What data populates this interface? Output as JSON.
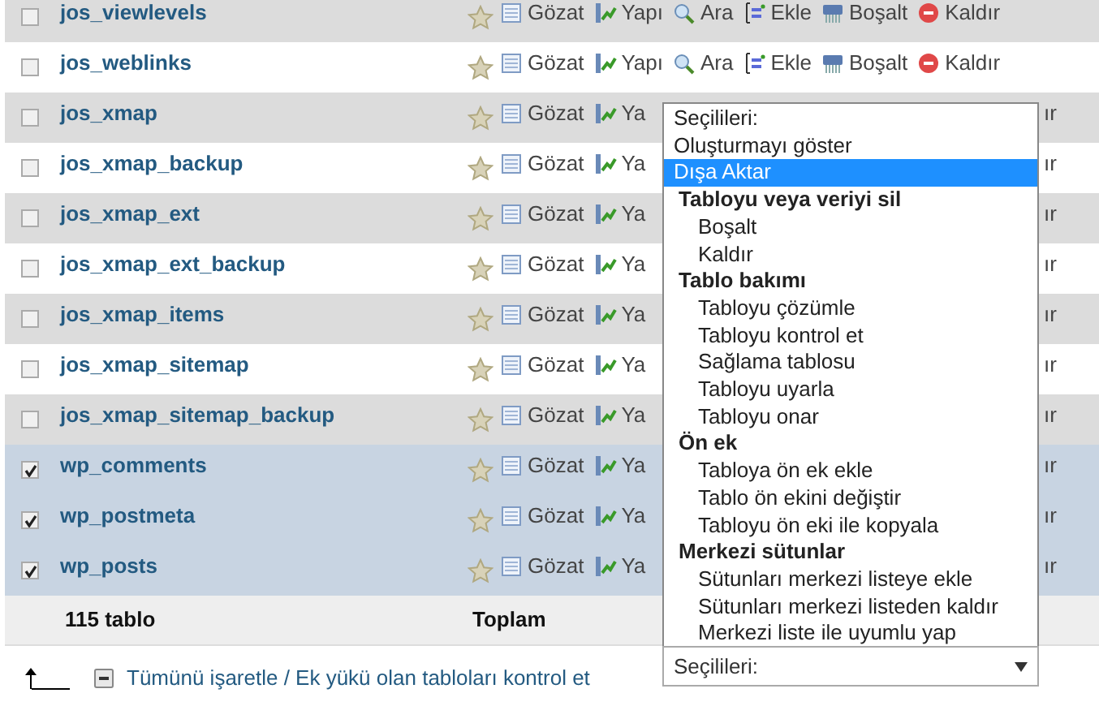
{
  "tables": [
    {
      "name": "jos_viewlevels",
      "checked": false,
      "actions": [
        {
          "kind": "browse",
          "label": "Gözat"
        },
        {
          "kind": "structure",
          "label": "Yapı"
        },
        {
          "kind": "search",
          "label": "Ara"
        },
        {
          "kind": "insert",
          "label": "Ekle"
        },
        {
          "kind": "empty",
          "label": "Boşalt"
        },
        {
          "kind": "drop",
          "label": "Kaldır"
        }
      ]
    },
    {
      "name": "jos_weblinks",
      "checked": false,
      "actions": [
        {
          "kind": "browse",
          "label": "Gözat"
        },
        {
          "kind": "structure",
          "label": "Yapı"
        },
        {
          "kind": "search",
          "label": "Ara"
        },
        {
          "kind": "insert",
          "label": "Ekle"
        },
        {
          "kind": "empty",
          "label": "Boşalt"
        },
        {
          "kind": "drop",
          "label": "Kaldır"
        }
      ]
    },
    {
      "name": "jos_xmap",
      "checked": false,
      "actions": [
        {
          "kind": "browse",
          "label": "Gözat"
        },
        {
          "kind": "structure",
          "label": "Ya"
        }
      ],
      "tail": "ır"
    },
    {
      "name": "jos_xmap_backup",
      "checked": false,
      "actions": [
        {
          "kind": "browse",
          "label": "Gözat"
        },
        {
          "kind": "structure",
          "label": "Ya"
        }
      ],
      "tail": "ır"
    },
    {
      "name": "jos_xmap_ext",
      "checked": false,
      "actions": [
        {
          "kind": "browse",
          "label": "Gözat"
        },
        {
          "kind": "structure",
          "label": "Ya"
        }
      ],
      "tail": "ır"
    },
    {
      "name": "jos_xmap_ext_backup",
      "checked": false,
      "actions": [
        {
          "kind": "browse",
          "label": "Gözat"
        },
        {
          "kind": "structure",
          "label": "Ya"
        }
      ],
      "tail": "ır"
    },
    {
      "name": "jos_xmap_items",
      "checked": false,
      "actions": [
        {
          "kind": "browse",
          "label": "Gözat"
        },
        {
          "kind": "structure",
          "label": "Ya"
        }
      ],
      "tail": "ır"
    },
    {
      "name": "jos_xmap_sitemap",
      "checked": false,
      "actions": [
        {
          "kind": "browse",
          "label": "Gözat"
        },
        {
          "kind": "structure",
          "label": "Ya"
        }
      ],
      "tail": "ır"
    },
    {
      "name": "jos_xmap_sitemap_backup",
      "checked": false,
      "actions": [
        {
          "kind": "browse",
          "label": "Gözat"
        },
        {
          "kind": "structure",
          "label": "Ya"
        }
      ],
      "tail": "ır"
    },
    {
      "name": "wp_comments",
      "checked": true,
      "actions": [
        {
          "kind": "browse",
          "label": "Gözat"
        },
        {
          "kind": "structure",
          "label": "Ya"
        }
      ],
      "tail": "ır"
    },
    {
      "name": "wp_postmeta",
      "checked": true,
      "actions": [
        {
          "kind": "browse",
          "label": "Gözat"
        },
        {
          "kind": "structure",
          "label": "Ya"
        }
      ],
      "tail": "ır"
    },
    {
      "name": "wp_posts",
      "checked": true,
      "actions": [
        {
          "kind": "browse",
          "label": "Gözat"
        },
        {
          "kind": "structure",
          "label": "Ya"
        }
      ],
      "tail": "ır"
    }
  ],
  "footer": {
    "count": "115 tablo",
    "total_label": "Toplam"
  },
  "bulk": {
    "check_all_link": "Tümünü işaretle / Ek yükü olan tabloları kontrol et",
    "select": {
      "value": "Seçilileri:"
    }
  },
  "dropdown": {
    "items": [
      {
        "kind": "option",
        "label": "Seçilileri:",
        "selected": false
      },
      {
        "kind": "option",
        "label": "Oluşturmayı göster",
        "selected": false
      },
      {
        "kind": "option",
        "label": "Dışa Aktar",
        "selected": true
      },
      {
        "kind": "group",
        "label": "Tabloyu veya veriyi sil",
        "children": [
          {
            "label": "Boşalt",
            "selected": false
          },
          {
            "label": "Kaldır",
            "selected": false
          }
        ]
      },
      {
        "kind": "group",
        "label": "Tablo bakımı",
        "children": [
          {
            "label": "Tabloyu çözümle",
            "selected": false
          },
          {
            "label": "Tabloyu kontrol et",
            "selected": false
          },
          {
            "label": "Sağlama tablosu",
            "selected": false
          },
          {
            "label": "Tabloyu uyarla",
            "selected": false
          },
          {
            "label": "Tabloyu onar",
            "selected": false
          }
        ]
      },
      {
        "kind": "group",
        "label": "Ön ek",
        "children": [
          {
            "label": "Tabloya ön ek ekle",
            "selected": false
          },
          {
            "label": "Tablo ön ekini değiştir",
            "selected": false
          },
          {
            "label": "Tabloyu ön eki ile kopyala",
            "selected": false
          }
        ]
      },
      {
        "kind": "group",
        "label": "Merkezi sütunlar",
        "children": [
          {
            "label": "Sütunları merkezi listeye ekle",
            "selected": false
          },
          {
            "label": "Sütunları merkezi listeden kaldır",
            "selected": false
          },
          {
            "label": "Merkezi liste ile uyumlu yap",
            "selected": false
          }
        ]
      }
    ]
  }
}
